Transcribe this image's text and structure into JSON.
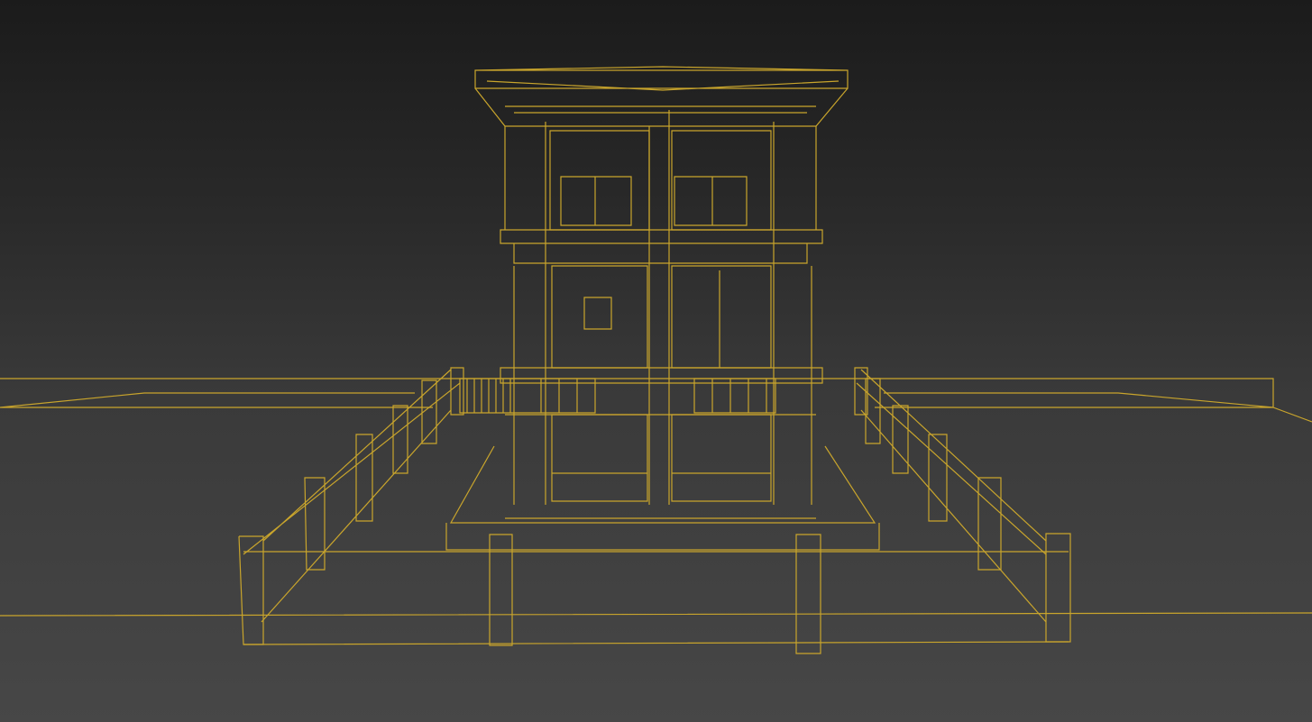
{
  "viewport": {
    "wire_color": "#c9a52c",
    "background_top": "#1b1b1b",
    "background_bottom": "#474747"
  }
}
